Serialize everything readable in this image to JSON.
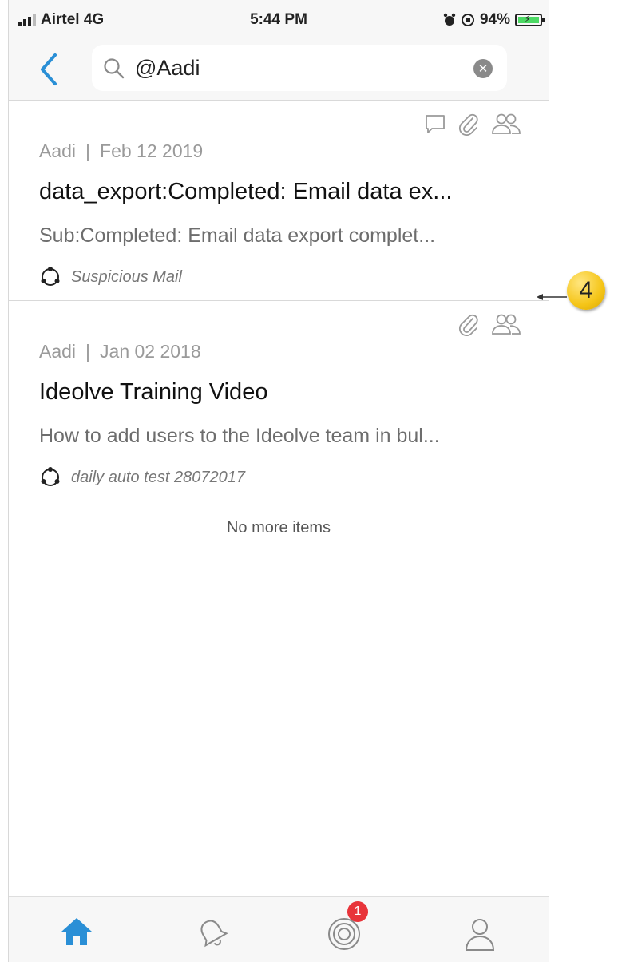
{
  "status_bar": {
    "carrier": "Airtel 4G",
    "time": "5:44 PM",
    "battery": "94%"
  },
  "search": {
    "query": "@Aadi"
  },
  "results": [
    {
      "author": "Aadi",
      "separator": "|",
      "date": "Feb 12 2019",
      "title": "data_export:Completed: Email data ex...",
      "subtitle": "Sub:Completed: Email data export complet...",
      "team": "Suspicious Mail",
      "icons": [
        "comment-icon",
        "attachment-icon",
        "people-icon"
      ]
    },
    {
      "author": "Aadi",
      "separator": "|",
      "date": "Jan 02 2018",
      "title": "Ideolve Training Video",
      "subtitle": "How to add users to the Ideolve team in bul...",
      "team": "daily auto test 28072017",
      "icons": [
        "attachment-icon",
        "people-icon"
      ]
    }
  ],
  "footer_text": "No more items",
  "tab_bar": {
    "tabs": [
      "home-icon",
      "bell-icon",
      "at-mention-icon",
      "profile-icon"
    ],
    "mentions_badge": "1",
    "active_color": "#2a8fd6"
  },
  "annotation": {
    "number": "4"
  }
}
